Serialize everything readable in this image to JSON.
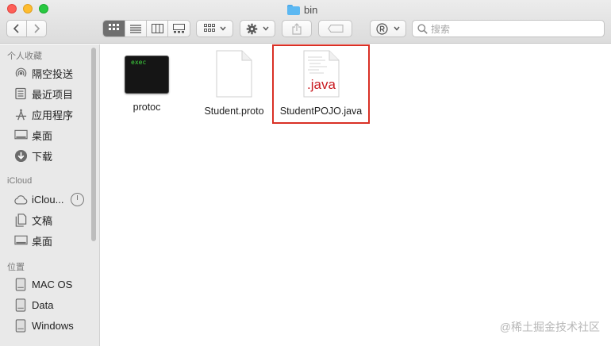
{
  "window": {
    "title": "bin"
  },
  "toolbar": {
    "back_icon": "chevron-left-icon",
    "forward_icon": "chevron-right-icon",
    "view_modes": [
      "icon-view",
      "list-view",
      "column-view",
      "gallery-view"
    ],
    "active_view": "icon-view",
    "search_placeholder": "搜索"
  },
  "sidebar": {
    "favorites_header": "个人收藏",
    "favorites": [
      {
        "label": "隔空投送",
        "icon": "airdrop-icon"
      },
      {
        "label": "最近项目",
        "icon": "recents-icon"
      },
      {
        "label": "应用程序",
        "icon": "applications-icon"
      },
      {
        "label": "桌面",
        "icon": "desktop-icon"
      },
      {
        "label": "下载",
        "icon": "downloads-icon"
      }
    ],
    "icloud_header": "iCloud",
    "icloud": [
      {
        "label": "iClou...",
        "icon": "cloud-icon"
      },
      {
        "label": "文稿",
        "icon": "documents-icon"
      },
      {
        "label": "桌面",
        "icon": "desktop-icon"
      }
    ],
    "locations_header": "位置",
    "locations": [
      {
        "label": "MAC OS",
        "icon": "disk-icon"
      },
      {
        "label": "Data",
        "icon": "disk-icon"
      },
      {
        "label": "Windows",
        "icon": "disk-icon"
      }
    ]
  },
  "files": [
    {
      "name": "protoc",
      "icon_text": "exec",
      "icon": "executable-icon"
    },
    {
      "name": "Student.proto",
      "icon": "document-icon"
    },
    {
      "name": "StudentPOJO.java",
      "icon_text": ".java",
      "icon": "java-file-icon",
      "highlighted": true
    }
  ],
  "colors": {
    "highlight": "#d93025",
    "java_label": "#c8191f",
    "exec_text": "#3ed63e"
  },
  "watermark": "@稀土掘金技术社区"
}
